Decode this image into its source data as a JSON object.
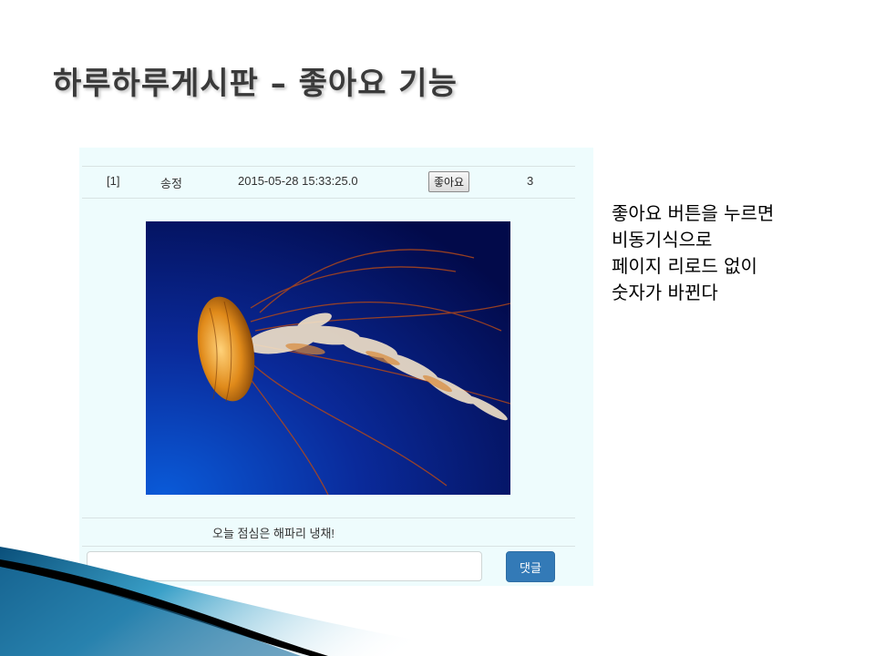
{
  "slide": {
    "title": "하루하루게시판 – 좋아요 기능"
  },
  "post": {
    "number": "[1]",
    "author": "송정",
    "timestamp": "2015-05-28 15:33:25.0",
    "like_button_label": "좋아요",
    "like_count": "3",
    "caption": "오늘 점심은 해파리 냉채!"
  },
  "comment": {
    "input_value": "",
    "submit_label": "댓글"
  },
  "note": {
    "lines": [
      "좋아요 버튼을 누르면",
      "비동기식으로",
      "페이지 리로드 없이",
      "숫자가 바뀐다"
    ]
  },
  "colors": {
    "board_bg": "#eefcfd",
    "reply_button": "#337ab7",
    "photo_deep": "#020a4a",
    "photo_light": "#0a5ad8"
  },
  "icons": {
    "photo": "jellyfish-photo",
    "decor": "blue-swoosh-decoration"
  }
}
